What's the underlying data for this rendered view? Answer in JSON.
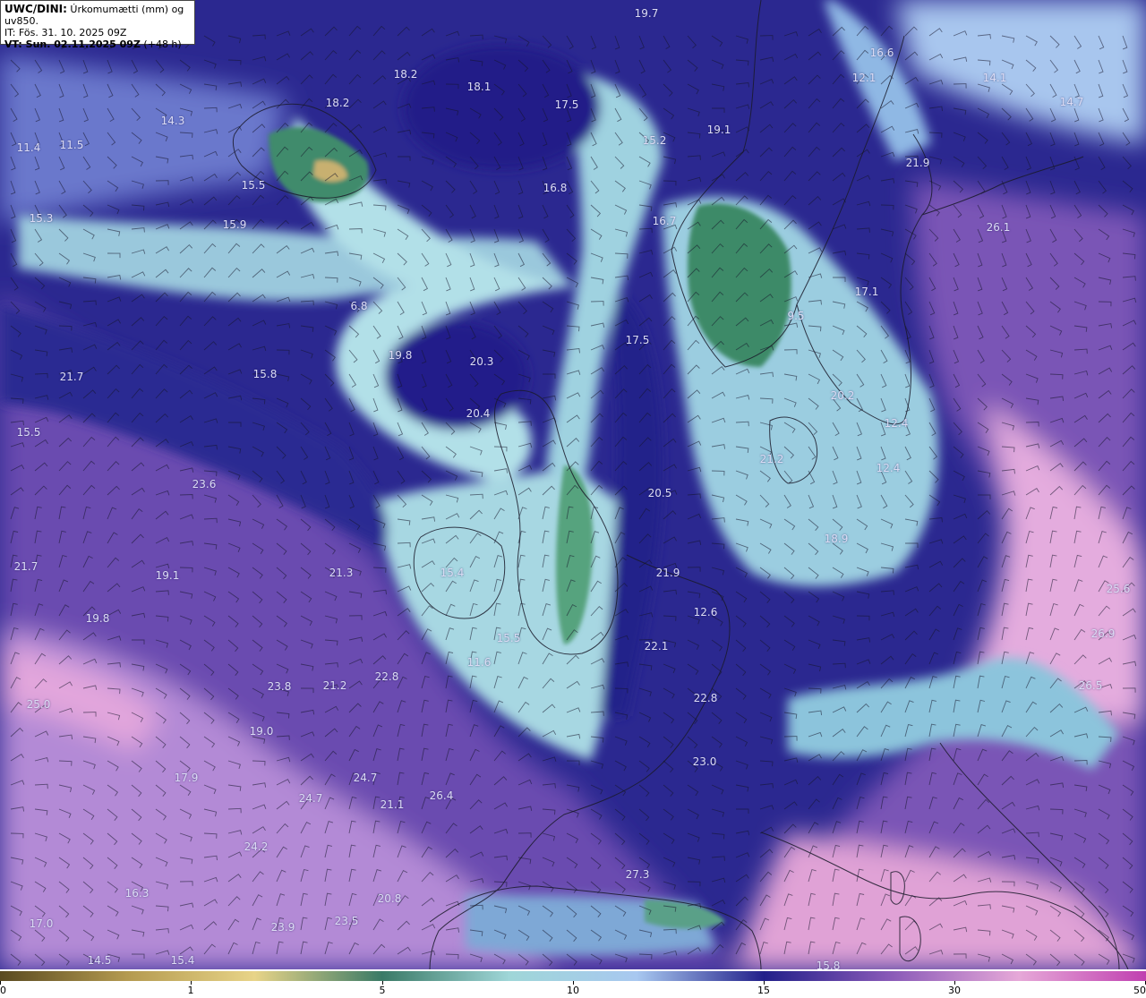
{
  "header": {
    "line1_bold": "UWC/DINI:",
    "line1_rest": " Úrkomumætti (mm) og uv850.",
    "line2": "IT: Fös. 31. 10. 2025 09Z",
    "line3_bold": "VT: Sun. 02.11.2025 09Z",
    "line3_rest": " (+48 h)"
  },
  "colors": {
    "ocean_dark": "#22208a",
    "moist_light": "#a9dce6",
    "green_core": "#3d8a6a",
    "purple": "#7a52b0",
    "pink": "#e9a6d8"
  },
  "labels": [
    {
      "t": "19.7"
    },
    {
      "t": "16.6"
    },
    {
      "t": "12.1"
    },
    {
      "t": "14.1"
    },
    {
      "t": "14.7"
    },
    {
      "t": "18.2"
    },
    {
      "t": "18.1"
    },
    {
      "t": "18.2"
    },
    {
      "t": "17.5"
    },
    {
      "t": "15.2"
    },
    {
      "t": "19.1"
    },
    {
      "t": "14.3"
    },
    {
      "t": "11.4"
    },
    {
      "t": "11.5"
    },
    {
      "t": "21.9"
    },
    {
      "t": "15.5"
    },
    {
      "t": "16.8"
    },
    {
      "t": "15.3"
    },
    {
      "t": "15.9"
    },
    {
      "t": "16.7"
    },
    {
      "t": "26.1"
    },
    {
      "t": "17.1"
    },
    {
      "t": "6.8"
    },
    {
      "t": "9.5"
    },
    {
      "t": "17.5"
    },
    {
      "t": "19.8"
    },
    {
      "t": "20.3"
    },
    {
      "t": "21.7"
    },
    {
      "t": "15.8"
    },
    {
      "t": "20.2"
    },
    {
      "t": "20.4"
    },
    {
      "t": "12.4"
    },
    {
      "t": "15.5"
    },
    {
      "t": "21.2"
    },
    {
      "t": "12.4"
    },
    {
      "t": "23.6"
    },
    {
      "t": "20.5"
    },
    {
      "t": "18.9"
    },
    {
      "t": "21.7"
    },
    {
      "t": "19.1"
    },
    {
      "t": "21.3"
    },
    {
      "t": "15.4"
    },
    {
      "t": "21.9"
    },
    {
      "t": "12.6"
    },
    {
      "t": "19.8"
    },
    {
      "t": "15.5"
    },
    {
      "t": "22.1"
    },
    {
      "t": "11.6"
    },
    {
      "t": "23.8"
    },
    {
      "t": "21.2"
    },
    {
      "t": "22.8"
    },
    {
      "t": "22.8"
    },
    {
      "t": "25.0"
    },
    {
      "t": "19.0"
    },
    {
      "t": "23.0"
    },
    {
      "t": "17.9"
    },
    {
      "t": "24.7"
    },
    {
      "t": "24.7"
    },
    {
      "t": "26.4"
    },
    {
      "t": "21.1"
    },
    {
      "t": "24.2"
    },
    {
      "t": "27.3"
    },
    {
      "t": "16.3"
    },
    {
      "t": "20.8"
    },
    {
      "t": "17.0"
    },
    {
      "t": "23.9"
    },
    {
      "t": "23.5"
    },
    {
      "t": "14.5"
    },
    {
      "t": "15.4"
    },
    {
      "t": "15.8"
    },
    {
      "t": "25.6"
    },
    {
      "t": "26.9"
    },
    {
      "t": "26.5"
    }
  ],
  "colorbar": {
    "ticks": [
      "0",
      "1",
      "5",
      "10",
      "15",
      "30",
      "50"
    ],
    "stops": [
      "#5a4a20",
      "#b49a50",
      "#e8d488",
      "#3a7a66",
      "#9fd6d8",
      "#a8c8f0",
      "#22208a",
      "#8a5ab8",
      "#e6a8d8",
      "#c040b0"
    ]
  }
}
